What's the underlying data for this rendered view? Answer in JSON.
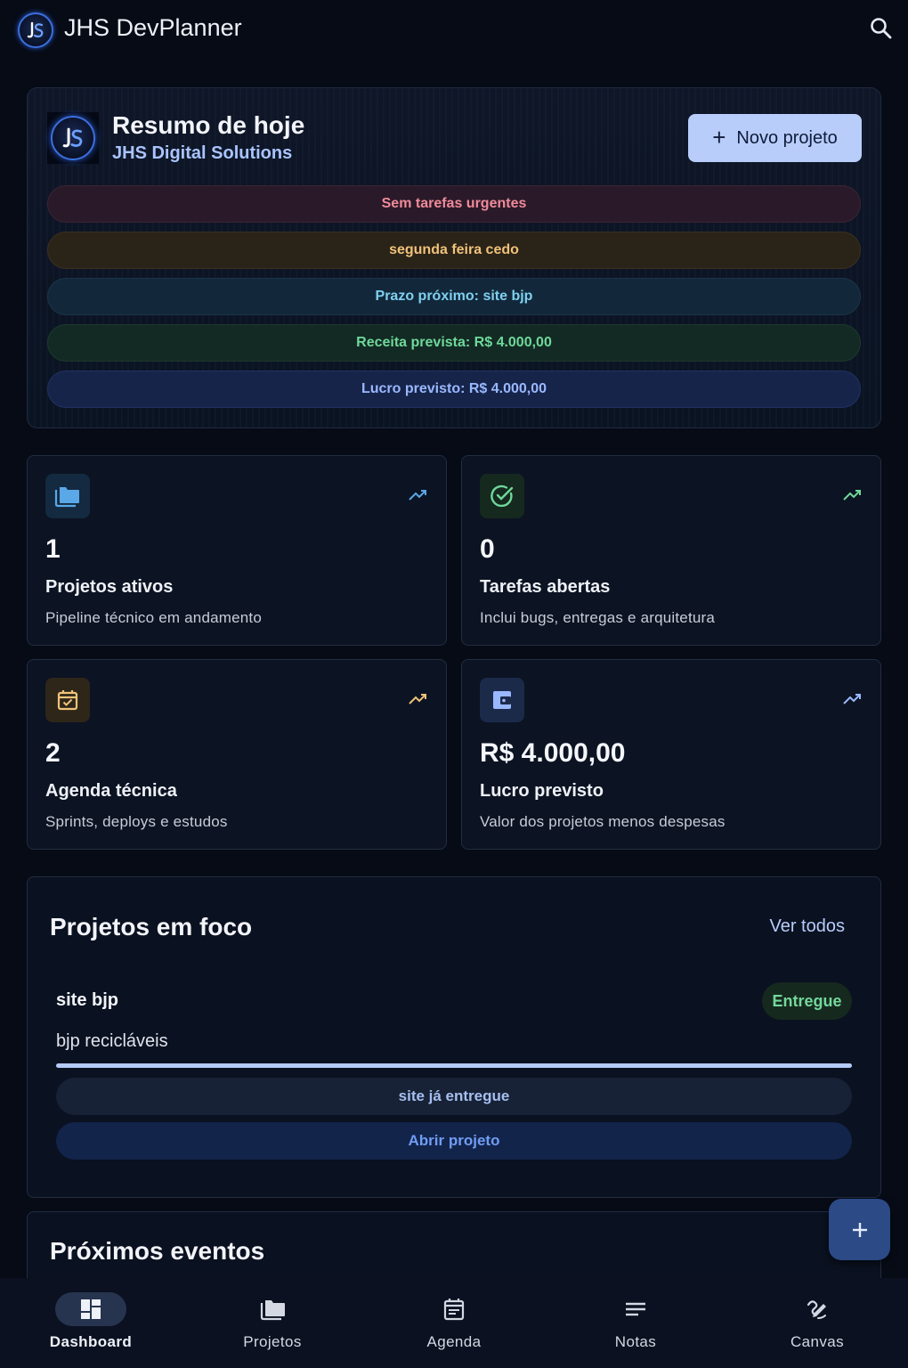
{
  "app": {
    "title": "JHS DevPlanner",
    "logo_icon": "jhs-logo-icon",
    "search_icon": "search-icon"
  },
  "summary": {
    "title": "Resumo de hoje",
    "company": "JHS Digital Solutions",
    "new_project_label": "Novo projeto",
    "alerts": [
      {
        "text": "Sem tarefas urgentes",
        "color": "#f08a9a"
      },
      {
        "text": "segunda feira cedo",
        "color": "#f0c27a"
      },
      {
        "text": "Prazo próximo: site bjp",
        "color": "#7fd0f0"
      },
      {
        "text": "Receita prevista: R$ 4.000,00",
        "color": "#6fd89a"
      },
      {
        "text": "Lucro previsto: R$ 4.000,00",
        "color": "#9ab8ff"
      }
    ]
  },
  "stats": [
    {
      "icon": "folder-icon",
      "value": "1",
      "label": "Projetos ativos",
      "description": "Pipeline técnico em andamento",
      "accent": "#5aa8e8"
    },
    {
      "icon": "check-circle-icon",
      "value": "0",
      "label": "Tarefas abertas",
      "description": "Inclui bugs, entregas e arquitetura",
      "accent": "#6fd89a"
    },
    {
      "icon": "calendar-check-icon",
      "value": "2",
      "label": "Agenda técnica",
      "description": "Sprints, deploys e estudos",
      "accent": "#f0c27a"
    },
    {
      "icon": "wallet-icon",
      "value": "R$ 4.000,00",
      "label": "Lucro previsto",
      "description": "Valor dos projetos menos despesas",
      "accent": "#9ab8ff"
    }
  ],
  "focus": {
    "title": "Projetos em foco",
    "see_all_label": "Ver todos",
    "project": {
      "name": "site bjp",
      "status": "Entregue",
      "client": "bjp recicláveis",
      "progress": 1.0,
      "note": "site já entregue",
      "open_label": "Abrir projeto"
    }
  },
  "events": {
    "title": "Próximos eventos"
  },
  "nav": [
    {
      "label": "Dashboard",
      "icon": "dashboard-icon",
      "active": true
    },
    {
      "label": "Projetos",
      "icon": "folders-icon",
      "active": false
    },
    {
      "label": "Agenda",
      "icon": "calendar-icon",
      "active": false
    },
    {
      "label": "Notas",
      "icon": "notes-icon",
      "active": false
    },
    {
      "label": "Canvas",
      "icon": "draw-icon",
      "active": false
    }
  ]
}
